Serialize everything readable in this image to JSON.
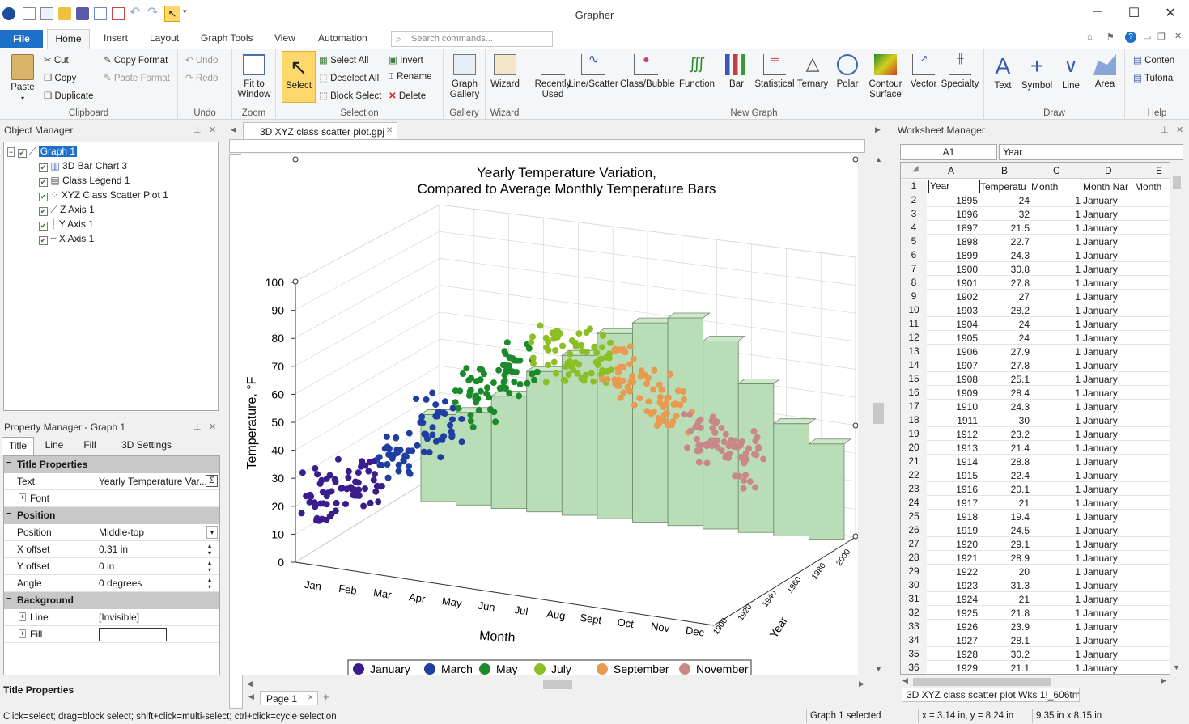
{
  "app": {
    "title": "Grapher"
  },
  "menu": {
    "file": "File",
    "tabs": [
      "Home",
      "Insert",
      "Layout",
      "Graph Tools",
      "View",
      "Automation"
    ],
    "search_placeholder": "Search commands..."
  },
  "ribbon": {
    "clipboard": {
      "paste": "Paste",
      "cut": "Cut",
      "copy": "Copy",
      "duplicate": "Duplicate",
      "copy_format": "Copy Format",
      "paste_format": "Paste Format",
      "label": "Clipboard"
    },
    "undo": {
      "undo": "Undo",
      "redo": "Redo",
      "label": "Undo"
    },
    "zoom": {
      "fit": "Fit to Window",
      "label": "Zoom"
    },
    "selection": {
      "select": "Select",
      "select_all": "Select All",
      "deselect_all": "Deselect All",
      "block_select": "Block Select",
      "invert": "Invert",
      "rename": "Rename",
      "delete": "Delete",
      "label": "Selection"
    },
    "gallery": {
      "graph_gallery": "Graph Gallery",
      "label": "Gallery"
    },
    "wizard": {
      "wizard": "Wizard",
      "label": "Wizard"
    },
    "newgraph": {
      "items": [
        "Recently Used",
        "Line/Scatter",
        "Class/Bubble",
        "Function",
        "Bar",
        "Statistical",
        "Ternary",
        "Polar",
        "Contour Surface",
        "Vector",
        "Specialty"
      ],
      "label": "New Graph"
    },
    "draw": {
      "items": [
        "Text",
        "Symbol",
        "Line",
        "Area"
      ],
      "label": "Draw"
    },
    "help": {
      "contents": "Conten",
      "tutorial": "Tutoria",
      "label": "Help"
    }
  },
  "object_manager": {
    "title": "Object Manager",
    "items": [
      "Graph 1",
      "3D Bar Chart 3",
      "Class Legend 1",
      "XYZ Class Scatter Plot 1",
      "Z Axis 1",
      "Y Axis 1",
      "X Axis 1"
    ]
  },
  "property_manager": {
    "title": "Property Manager - Graph 1",
    "tabs": [
      "Title",
      "Line",
      "Fill",
      "3D Settings"
    ],
    "sections": {
      "title_props": "Title Properties",
      "position": "Position",
      "background": "Background"
    },
    "rows": {
      "text_k": "Text",
      "text_v": "Yearly Temperature Var...",
      "font_k": "Font",
      "position_k": "Position",
      "position_v": "Middle-top",
      "xoff_k": "X offset",
      "xoff_v": "0.31 in",
      "yoff_k": "Y offset",
      "yoff_v": "0 in",
      "angle_k": "Angle",
      "angle_v": "0 degrees",
      "line_k": "Line",
      "line_v": "[Invisible]",
      "fill_k": "Fill"
    },
    "help_title": "Title Properties"
  },
  "document": {
    "tab": "3D XYZ class scatter plot.gpj",
    "page_tab": "Page 1"
  },
  "chart_data": {
    "type": "scatter",
    "title": "Yearly Temperature Variation,",
    "subtitle": "Compared to Average Monthly Temperature Bars",
    "xlabel": "Month",
    "ylabel": "Temperature, °F",
    "zlabel": "Year",
    "categories": [
      "Jan",
      "Feb",
      "Mar",
      "Apr",
      "May",
      "Jun",
      "Jul",
      "Aug",
      "Sept",
      "Oct",
      "Nov",
      "Dec"
    ],
    "yticks": [
      0,
      10,
      20,
      30,
      40,
      50,
      60,
      70,
      80,
      90,
      100
    ],
    "ylim": [
      0,
      100
    ],
    "zticks": [
      "1900",
      "1920",
      "1940",
      "1960",
      "1980",
      "2000"
    ],
    "bar_values": [
      31,
      33,
      40,
      50,
      57,
      66,
      71,
      74,
      67,
      53,
      40,
      34
    ],
    "legend": [
      "January",
      "March",
      "May",
      "July",
      "September",
      "November"
    ],
    "series_colors": [
      "#3b1c8c",
      "#1f3fa0",
      "#1a8a2a",
      "#8cbf26",
      "#e89a50",
      "#c98888"
    ],
    "bar_color": "#b9ddb6",
    "grid": true
  },
  "worksheet": {
    "title": "Worksheet Manager",
    "cell_ref": "A1",
    "cell_value": "Year",
    "columns": [
      "A",
      "B",
      "C",
      "D",
      "E"
    ],
    "header_row": [
      "Year",
      "Temperatu",
      "Month",
      "Month Nar",
      "Month"
    ],
    "rows": [
      [
        "1895",
        "24",
        "1",
        "January"
      ],
      [
        "1896",
        "32",
        "1",
        "January"
      ],
      [
        "1897",
        "21.5",
        "1",
        "January"
      ],
      [
        "1898",
        "22.7",
        "1",
        "January"
      ],
      [
        "1899",
        "24.3",
        "1",
        "January"
      ],
      [
        "1900",
        "30.8",
        "1",
        "January"
      ],
      [
        "1901",
        "27.8",
        "1",
        "January"
      ],
      [
        "1902",
        "27",
        "1",
        "January"
      ],
      [
        "1903",
        "28.2",
        "1",
        "January"
      ],
      [
        "1904",
        "24",
        "1",
        "January"
      ],
      [
        "1905",
        "24",
        "1",
        "January"
      ],
      [
        "1906",
        "27.9",
        "1",
        "January"
      ],
      [
        "1907",
        "27.8",
        "1",
        "January"
      ],
      [
        "1908",
        "25.1",
        "1",
        "January"
      ],
      [
        "1909",
        "28.4",
        "1",
        "January"
      ],
      [
        "1910",
        "24.3",
        "1",
        "January"
      ],
      [
        "1911",
        "30",
        "1",
        "January"
      ],
      [
        "1912",
        "23.2",
        "1",
        "January"
      ],
      [
        "1913",
        "21.4",
        "1",
        "January"
      ],
      [
        "1914",
        "28.8",
        "1",
        "January"
      ],
      [
        "1915",
        "22.4",
        "1",
        "January"
      ],
      [
        "1916",
        "20.1",
        "1",
        "January"
      ],
      [
        "1917",
        "21",
        "1",
        "January"
      ],
      [
        "1918",
        "19.4",
        "1",
        "January"
      ],
      [
        "1919",
        "24.5",
        "1",
        "January"
      ],
      [
        "1920",
        "29.1",
        "1",
        "January"
      ],
      [
        "1921",
        "28.9",
        "1",
        "January"
      ],
      [
        "1922",
        "20",
        "1",
        "January"
      ],
      [
        "1923",
        "31.3",
        "1",
        "January"
      ],
      [
        "1924",
        "21",
        "1",
        "January"
      ],
      [
        "1925",
        "21.8",
        "1",
        "January"
      ],
      [
        "1926",
        "23.9",
        "1",
        "January"
      ],
      [
        "1927",
        "28.1",
        "1",
        "January"
      ],
      [
        "1928",
        "30.2",
        "1",
        "January"
      ],
      [
        "1929",
        "21.1",
        "1",
        "January"
      ]
    ],
    "sheet_tab": "3D XYZ class scatter plot Wks 1!_606tmp"
  },
  "status": {
    "hint": "Click=select; drag=block select; shift+click=multi-select; ctrl+click=cycle selection",
    "selected": "Graph 1 selected",
    "coords": "x = 3.14 in, y = 8.24 in",
    "size": "9.35 in x 8.15 in"
  }
}
